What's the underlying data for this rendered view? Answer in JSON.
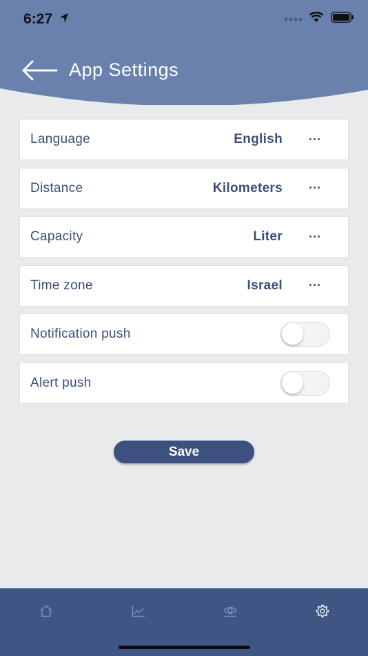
{
  "status_bar": {
    "time": "6:27"
  },
  "header": {
    "title": "App Settings"
  },
  "settings": [
    {
      "label": "Language",
      "value": "English",
      "type": "select"
    },
    {
      "label": "Distance",
      "value": "Kilometers",
      "type": "select"
    },
    {
      "label": "Capacity",
      "value": "Liter",
      "type": "select"
    },
    {
      "label": "Time zone",
      "value": "Israel",
      "type": "select"
    },
    {
      "label": "Notification push",
      "type": "toggle",
      "on": false
    },
    {
      "label": "Alert push",
      "type": "toggle",
      "on": false
    }
  ],
  "more_glyph": "···",
  "save_label": "Save",
  "nav": {
    "items": [
      "home-icon",
      "chart-icon",
      "eye-icon",
      "gear-icon"
    ],
    "active": "gear-icon"
  },
  "colors": {
    "header": "#6a81ad",
    "primary": "#3d5181",
    "text": "#3b4d78",
    "background": "#e9eaec",
    "nav": "#3f5583"
  }
}
